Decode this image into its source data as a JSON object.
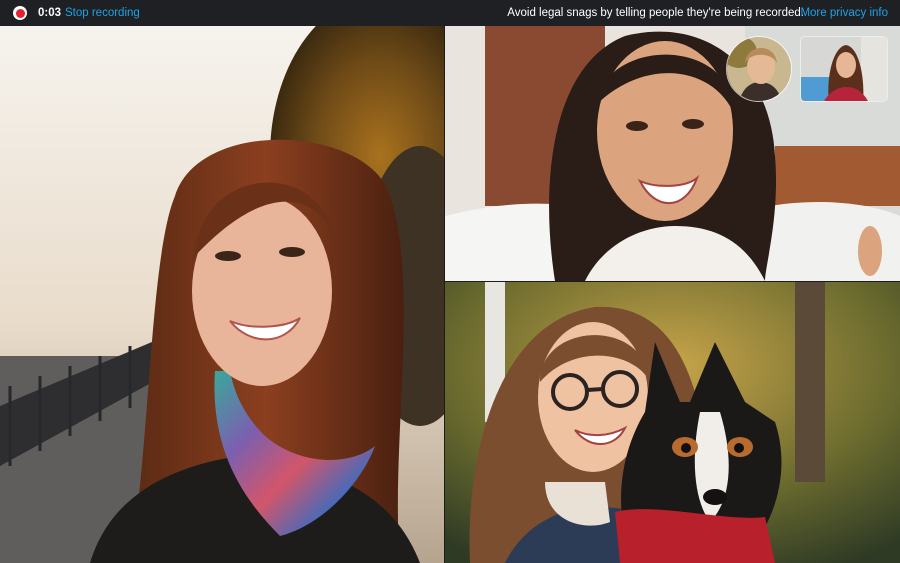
{
  "recording": {
    "elapsed": "0:03",
    "stop_label": "Stop recording",
    "notice": "Avoid legal snags by telling people they're being recorded.",
    "privacy_link": "More privacy info",
    "indicator_color": "#e3242f",
    "link_color": "#1ea3e6"
  },
  "participants": [
    {
      "slot": "main-left",
      "icon": "person-video"
    },
    {
      "slot": "top-right",
      "icon": "person-video"
    },
    {
      "slot": "bottom-right",
      "icon": "person-video"
    },
    {
      "slot": "thumbnail-round",
      "icon": "person-video"
    },
    {
      "slot": "thumbnail-rect",
      "icon": "person-video"
    }
  ]
}
